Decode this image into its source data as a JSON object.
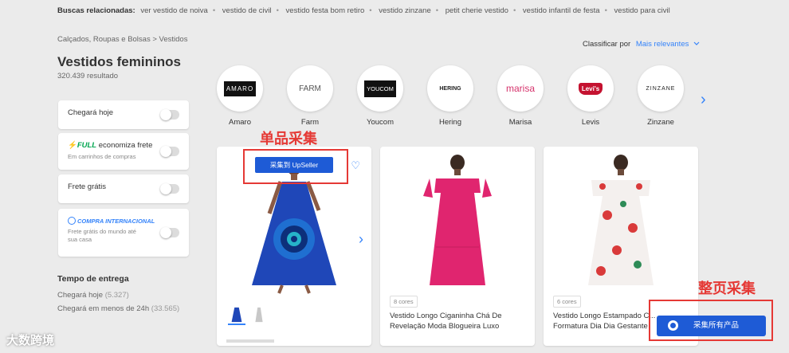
{
  "related": {
    "label": "Buscas relacionadas:",
    "items": [
      "ver vestido de noiva",
      "vestido de civil",
      "vestido festa bom retiro",
      "vestido zinzane",
      "petit cherie vestido",
      "vestido infantil de festa",
      "vestido para civil"
    ]
  },
  "breadcrumb": "Calçados, Roupas e Bolsas > Vestidos",
  "page_title": "Vestidos femininos",
  "result_count": "320.439 resultado",
  "sort": {
    "label": "Classificar por",
    "value": "Mais relevantes"
  },
  "filters": {
    "today": "Chegará hoje",
    "full_word": "FULL",
    "full_text": "economiza frete",
    "full_sub": "Em carrinhos de compras",
    "free_shipping": "Frete grátis",
    "intl_title": "COMPRA INTERNACIONAL",
    "intl_sub": "Frete grátis do mundo até sua casa"
  },
  "delivery": {
    "title": "Tempo de entrega",
    "items": [
      {
        "label": "Chegará hoje",
        "count": "(5.327)"
      },
      {
        "label": "Chegará em menos de 24h",
        "count": "(33.565)"
      }
    ]
  },
  "brands": [
    {
      "name": "Amaro",
      "logo": "AMARO"
    },
    {
      "name": "Farm",
      "logo": "FARM"
    },
    {
      "name": "Youcom",
      "logo": "YOUCOM"
    },
    {
      "name": "Hering",
      "logo": "HERING"
    },
    {
      "name": "Marisa",
      "logo": "marisa"
    },
    {
      "name": "Levis",
      "logo": "Levi's"
    },
    {
      "name": "Zinzane",
      "logo": "ZINZANE"
    }
  ],
  "products": [
    {
      "chip": "",
      "title": ""
    },
    {
      "chip": "8 cores",
      "title": "Vestido Longo Ciganinha Chá De Revelação Moda Blogueira Luxo"
    },
    {
      "chip": "6 cores",
      "title": "Vestido Longo Estampado C... Formatura Dia Dia Gestante"
    }
  ],
  "upseller_button": "采集到 UpSeller",
  "collect_all_button": "采集所有产品",
  "annotations": {
    "single": "单品采集",
    "all": "整页采集"
  },
  "watermark": "大数跨境",
  "colors": {
    "accent": "#3483fa",
    "plugin_button": "#1e5bd6",
    "annotation": "#e53935",
    "full": "#00a650"
  },
  "icons": [
    "chevron-right-icon",
    "heart-icon",
    "bolt-icon",
    "globe-icon",
    "chevron-down-icon",
    "toggle-icon"
  ]
}
